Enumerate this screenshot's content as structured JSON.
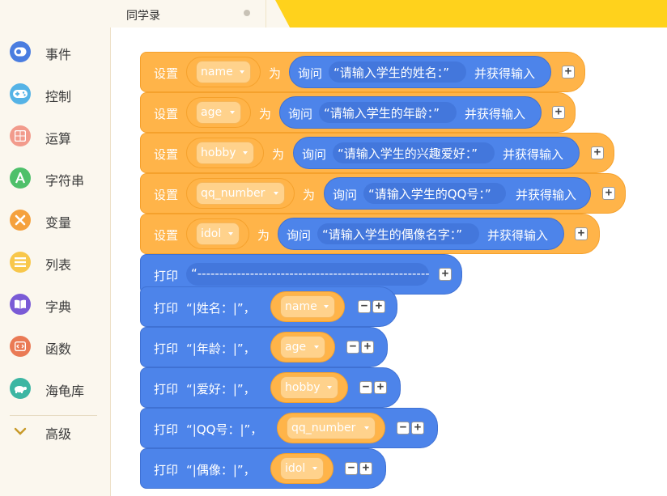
{
  "tab": {
    "title": "同学录"
  },
  "sidebar": {
    "items": [
      {
        "label": "事件",
        "icon": "event-icon",
        "color": "#4a7de0"
      },
      {
        "label": "控制",
        "icon": "gamepad-icon",
        "color": "#55b3e6"
      },
      {
        "label": "运算",
        "icon": "calculator-icon",
        "color": "#f29b8c"
      },
      {
        "label": "字符串",
        "icon": "string-icon",
        "color": "#4ec06a"
      },
      {
        "label": "变量",
        "icon": "variable-icon",
        "color": "#f5a13d"
      },
      {
        "label": "列表",
        "icon": "list-icon",
        "color": "#f8c74b"
      },
      {
        "label": "字典",
        "icon": "dictionary-icon",
        "color": "#7a5bd6"
      },
      {
        "label": "函数",
        "icon": "function-icon",
        "color": "#ea7a55"
      },
      {
        "label": "海龟库",
        "icon": "turtle-icon",
        "color": "#3cb6a3"
      },
      {
        "label": "高级",
        "icon": "chevron-down-icon",
        "color": "#c89a2a"
      }
    ]
  },
  "blocks": {
    "set_label": "设置",
    "as_label": "为",
    "ask_label": "询问",
    "ask_suffix": "并获得输入",
    "print_label": "打印",
    "sets": [
      {
        "var": "name",
        "prompt": "“请输入学生的姓名：”"
      },
      {
        "var": "age",
        "prompt": "“请输入学生的年龄：”"
      },
      {
        "var": "hobby",
        "prompt": "“请输入学生的兴趣爱好：”"
      },
      {
        "var": "qq_number",
        "prompt": "“请输入学生的QQ号：”"
      },
      {
        "var": "idol",
        "prompt": "“请输入学生的偶像名字：”"
      }
    ],
    "print_line": "“-------------------------------------------------------...”",
    "prints": [
      {
        "text": "“|姓名：|”，",
        "var": "name"
      },
      {
        "text": "“|年龄：|”，",
        "var": "age"
      },
      {
        "text": "“|爱好：|”，",
        "var": "hobby"
      },
      {
        "text": "“|QQ号：|”，",
        "var": "qq_number"
      },
      {
        "text": "“|偶像：|”，",
        "var": "idol"
      }
    ],
    "plus": "+",
    "minus": "−"
  }
}
